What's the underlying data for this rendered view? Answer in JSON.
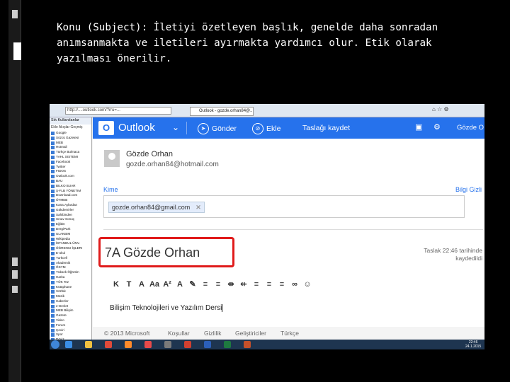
{
  "slide": {
    "line1": "Konu (Subject): İletiyi özetleyen başlık, genelde daha sonradan",
    "line2": "anımsanmakta ve iletileri ayırmakta yardımcı olur. Etik olarak",
    "line3": "yazılması önerilir."
  },
  "browser": {
    "url": "http://....outlook.com/?rru=...",
    "tab_title": "Outlook - gozde.orhan84@..."
  },
  "favorites": {
    "header": "Sık Kullanılanlar",
    "tools": "Ekle  Akışlar  Geçmiş",
    "items": [
      "Google",
      "Sözcü Gazetesi",
      "MEB",
      "Hotmail",
      "Türkçe Bulmaca",
      "YAHL SISTEMI",
      "Facebook",
      "Twitter",
      "FIDOS",
      "Outlook.com",
      "BAU",
      "BILKO BUAR",
      "Ş-FLB YÖNETIM",
      "Download.com",
      "ÖTMEB",
      "Kana.Aylardan",
      "Gökdemirler",
      "Sahibinden",
      "Sınav Sonuç",
      "Eğitim",
      "DergiPark",
      "ULAKBIM",
      "Wikipedia",
      "İSTANBUL ÜNV.",
      "ÖĞRENCI İŞLERI",
      "E-okul",
      "Turkcell",
      "Akademik",
      "ÖSYM",
      "Yüksek Öğretim",
      "Harita",
      "YÖK Tez",
      "Kütüphane",
      "Sözlük",
      "Müzik",
      "Haberler",
      "e-Devlet",
      "MEB Bilişim",
      "Gazete",
      "Video",
      "Forum",
      "Çeviri",
      "Spor",
      "Döviz",
      "Hava Durumu",
      "Yemek",
      "Sağlık",
      "Oyunlar"
    ]
  },
  "outlook": {
    "brand": "Outlook",
    "send_label": "Gönder",
    "attach_label": "Ekle",
    "save_draft_label": "Taslağı kaydet",
    "user_short": "Gözde O",
    "sender_name": "Gözde Orhan",
    "sender_email": "gozde.orhan84@hotmail.com",
    "to_label": "Kime",
    "bcc_label": "Bilgi Gizli",
    "recipient": "gozde.orhan84@gmail.com",
    "subject": "7A Gözde Orhan",
    "draft_line1": "Taslak 22:46 tarihinde",
    "draft_line2": "kaydedildi",
    "body": "Bilişim Teknolojileri ve Yazılım Dersi",
    "format_buttons": [
      "K",
      "T",
      "A",
      "Aa",
      "A²",
      "A",
      "✎",
      "≡",
      "≡",
      "⇹",
      "⇷",
      "≡",
      "≡",
      "≡",
      "∞",
      "☺"
    ]
  },
  "footer": {
    "copyright": "© 2013 Microsoft",
    "terms": "Koşullar",
    "privacy": "Gizlilik",
    "developers": "Geliştiriciler",
    "language": "Türkçe"
  },
  "taskbar": {
    "time": "22:46",
    "date": "24.1.2015"
  },
  "colors": {
    "outlook_blue": "#2672ec",
    "highlight_red": "#e01b1b",
    "slide_bg": "#000000"
  }
}
